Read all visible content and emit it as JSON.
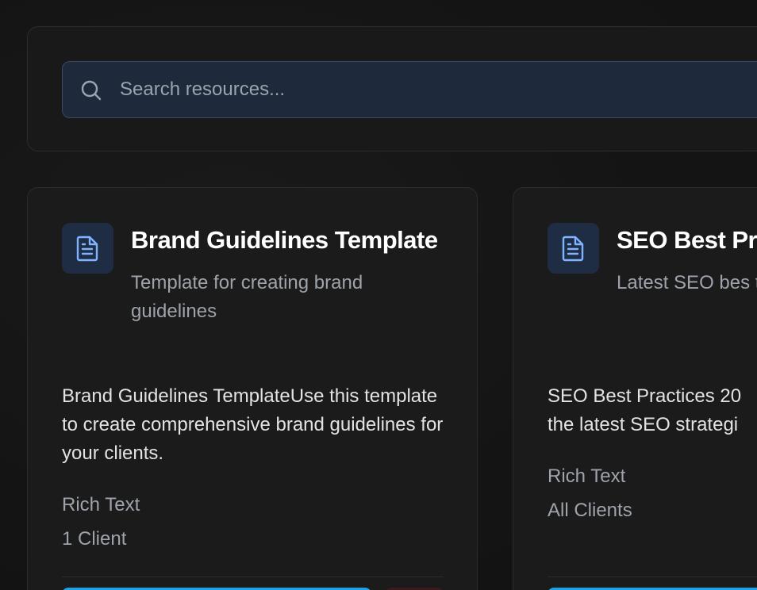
{
  "search": {
    "placeholder": "Search resources..."
  },
  "cards": [
    {
      "title": "Brand Guidelines Template",
      "subtitle": "Template for creating brand guidelines",
      "body": "Brand Guidelines TemplateUse this template to create comprehensive brand guidelines for your clients.",
      "type": "Rich Text",
      "clients": "1 Client",
      "icon": "document-icon"
    },
    {
      "title": "SEO Best Pra",
      "subtitle": "Latest SEO bes trends",
      "body_line1": "SEO Best Practices 20",
      "body_line2": "the latest SEO strategi",
      "type": "Rich Text",
      "clients": "All Clients",
      "icon": "document-icon"
    }
  ],
  "colors": {
    "accent": "#1aa3e8",
    "icon_blue": "#7fb3ff",
    "badge_bg": "#1f2d44"
  }
}
